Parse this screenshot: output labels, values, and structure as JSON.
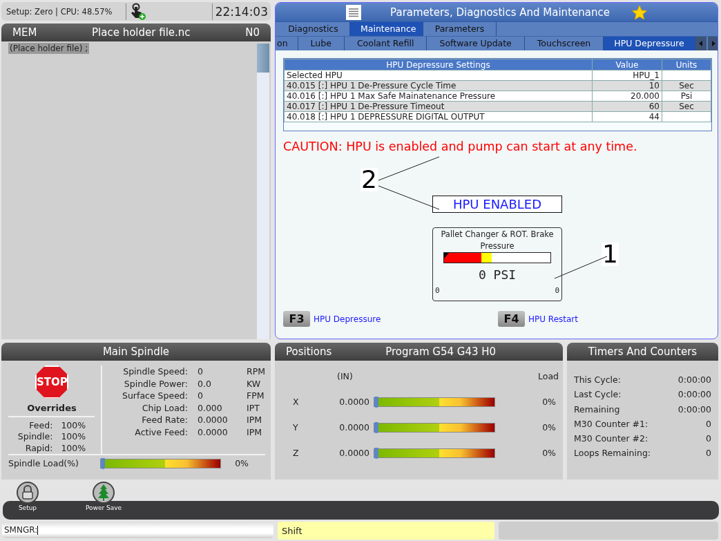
{
  "status_bar": {
    "info": "Setup: Zero | CPU: 48.57%",
    "time": "22:14:03"
  },
  "program": {
    "mode": "MEM",
    "file": "Place holder file.nc",
    "line": "N0",
    "code_lines": [
      {
        "text": "(Place holder file) ;",
        "selected": true
      }
    ]
  },
  "pdm": {
    "title": "Parameters, Diagnostics And Maintenance",
    "favorite": true,
    "tabs": [
      {
        "label": "Diagnostics",
        "selected": false
      },
      {
        "label": "Maintenance",
        "selected": true
      },
      {
        "label": "Parameters",
        "selected": false
      }
    ],
    "subtabs": [
      {
        "label": "on",
        "selected": false
      },
      {
        "label": "Lube",
        "selected": false
      },
      {
        "label": "Coolant Refill",
        "selected": false
      },
      {
        "label": "Software Update",
        "selected": false
      },
      {
        "label": "Touchscreen",
        "selected": false
      },
      {
        "label": "HPU Depressure",
        "selected": true
      }
    ],
    "table": {
      "columns": [
        "HPU Depressure Settings",
        "Value",
        "Units"
      ],
      "rows": [
        [
          "Selected HPU",
          "HPU_1",
          ""
        ],
        [
          "40.015 [:] HPU 1 De-Pressure Cycle Time",
          "10",
          "Sec"
        ],
        [
          "40.016 [:] HPU 1 Max Safe Mainatenance Pressure",
          "20.000",
          "Psi"
        ],
        [
          "40.017 [:] HPU 1 De-Pressure Timeout",
          "60",
          "Sec"
        ],
        [
          "40.018 [:] HPU 1 DEPRESSURE DIGITAL OUTPUT",
          "44",
          ""
        ]
      ]
    },
    "caution": "CAUTION: HPU is enabled and pump can start at any time.",
    "status": "HPU ENABLED",
    "gauge": {
      "title": "Pallet Changer & ROT. Brake Pressure",
      "level": 0,
      "reading": "0 PSI",
      "min": "0",
      "max": "0"
    },
    "softkeys": [
      {
        "key": "F3",
        "label": "HPU Depressure"
      },
      {
        "key": "F4",
        "label": "HPU Restart"
      }
    ],
    "callouts": [
      "2",
      "1"
    ]
  },
  "spindle": {
    "title": "Main Spindle",
    "stop": "STOP",
    "overrides_title": "Overrides",
    "overrides": [
      {
        "label": "Feed:",
        "value": "100%"
      },
      {
        "label": "Spindle:",
        "value": "100%"
      },
      {
        "label": "Rapid:",
        "value": "100%"
      }
    ],
    "readings": [
      {
        "label": "Spindle Speed:",
        "value": "0",
        "unit": "RPM"
      },
      {
        "label": "Spindle Power:",
        "value": "0.0",
        "unit": "KW"
      },
      {
        "label": "Surface Speed:",
        "value": "0",
        "unit": "FPM"
      },
      {
        "label": "Chip Load:",
        "value": "0.000",
        "unit": "IPT"
      },
      {
        "label": "Feed Rate:",
        "value": "0.0000",
        "unit": "IPM"
      },
      {
        "label": "Active Feed:",
        "value": "0.0000",
        "unit": "IPM"
      }
    ],
    "load": {
      "label": "Spindle Load(%)",
      "level": 0,
      "reading": "0%"
    }
  },
  "positions": {
    "title": "Positions",
    "program": "Program G54 G43 H0",
    "units": "(IN)",
    "load_heading": "Load",
    "axes": [
      {
        "axis": "X",
        "value": "0.0000",
        "level": 0,
        "reading": "0%"
      },
      {
        "axis": "Y",
        "value": "0.0000",
        "level": 0,
        "reading": "0%"
      },
      {
        "axis": "Z",
        "value": "0.0000",
        "level": 0,
        "reading": "0%"
      }
    ]
  },
  "timers": {
    "title": "Timers And Counters",
    "rows": [
      {
        "label": "This Cycle:",
        "value": "0:00:00"
      },
      {
        "label": "Last Cycle:",
        "value": "0:00:00"
      },
      {
        "label": "Remaining",
        "value": "0:00:00"
      },
      {
        "label": "M30 Counter #1:",
        "value": "0"
      },
      {
        "label": "M30 Counter #2:",
        "value": "0"
      },
      {
        "label": "Loops Remaining:",
        "value": "0"
      }
    ]
  },
  "dock": [
    {
      "kind": "lock",
      "label": "Setup"
    },
    {
      "kind": "tree",
      "label": "Power Save"
    }
  ],
  "command": {
    "prompt": "SMNGR:",
    "mode": "Shift"
  }
}
